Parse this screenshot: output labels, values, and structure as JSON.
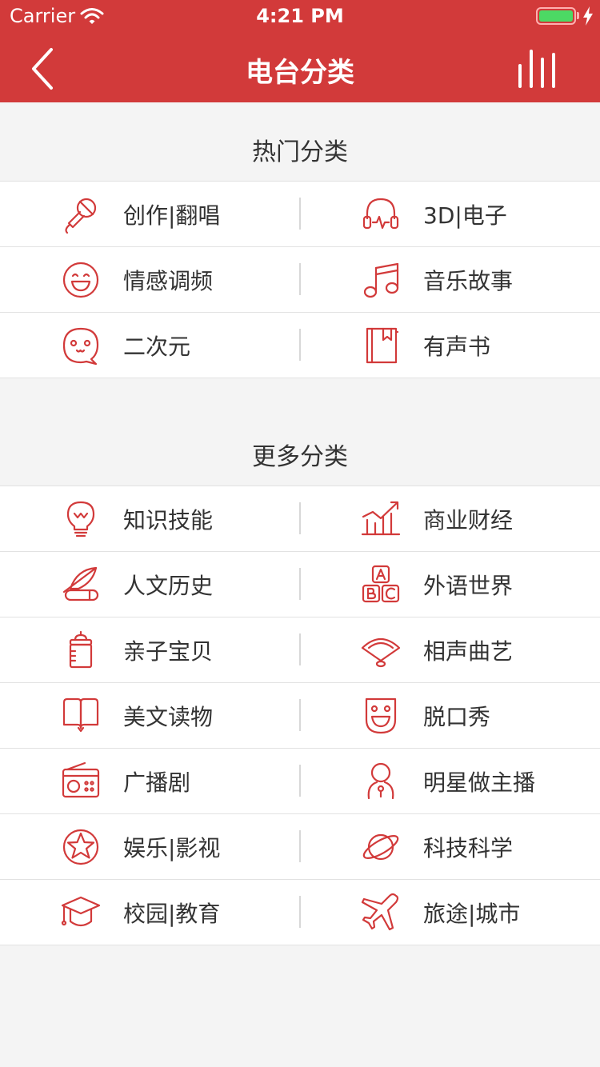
{
  "status": {
    "carrier": "Carrier",
    "time": "4:21 PM"
  },
  "nav": {
    "title": "电台分类"
  },
  "hot": {
    "title": "热门分类",
    "rows": [
      [
        {
          "label": "创作|翻唱",
          "icon": "microphone-icon"
        },
        {
          "label": "3D|电子",
          "icon": "headphones-icon"
        }
      ],
      [
        {
          "label": "情感调频",
          "icon": "smile-face-icon"
        },
        {
          "label": "音乐故事",
          "icon": "music-note-icon"
        }
      ],
      [
        {
          "label": "二次元",
          "icon": "cute-face-bubble-icon"
        },
        {
          "label": "有声书",
          "icon": "book-bookmark-icon"
        }
      ]
    ]
  },
  "more": {
    "title": "更多分类",
    "rows": [
      [
        {
          "label": "知识技能",
          "icon": "lightbulb-icon"
        },
        {
          "label": "商业财经",
          "icon": "chart-growth-icon"
        }
      ],
      [
        {
          "label": "人文历史",
          "icon": "quill-scroll-icon"
        },
        {
          "label": "外语世界",
          "icon": "abc-blocks-icon"
        }
      ],
      [
        {
          "label": "亲子宝贝",
          "icon": "baby-bottle-icon"
        },
        {
          "label": "相声曲艺",
          "icon": "fan-icon"
        }
      ],
      [
        {
          "label": "美文读物",
          "icon": "open-book-icon"
        },
        {
          "label": "脱口秀",
          "icon": "mask-icon"
        }
      ],
      [
        {
          "label": "广播剧",
          "icon": "radio-icon"
        },
        {
          "label": "明星做主播",
          "icon": "star-person-icon"
        }
      ],
      [
        {
          "label": "娱乐|影视",
          "icon": "star-circle-icon"
        },
        {
          "label": "科技科学",
          "icon": "planet-icon"
        }
      ],
      [
        {
          "label": "校园|教育",
          "icon": "graduation-cap-icon"
        },
        {
          "label": "旅途|城市",
          "icon": "airplane-icon"
        }
      ]
    ]
  },
  "colors": {
    "accent": "#d23a3a",
    "background": "#f4f4f4",
    "battery": "#4cd964"
  }
}
